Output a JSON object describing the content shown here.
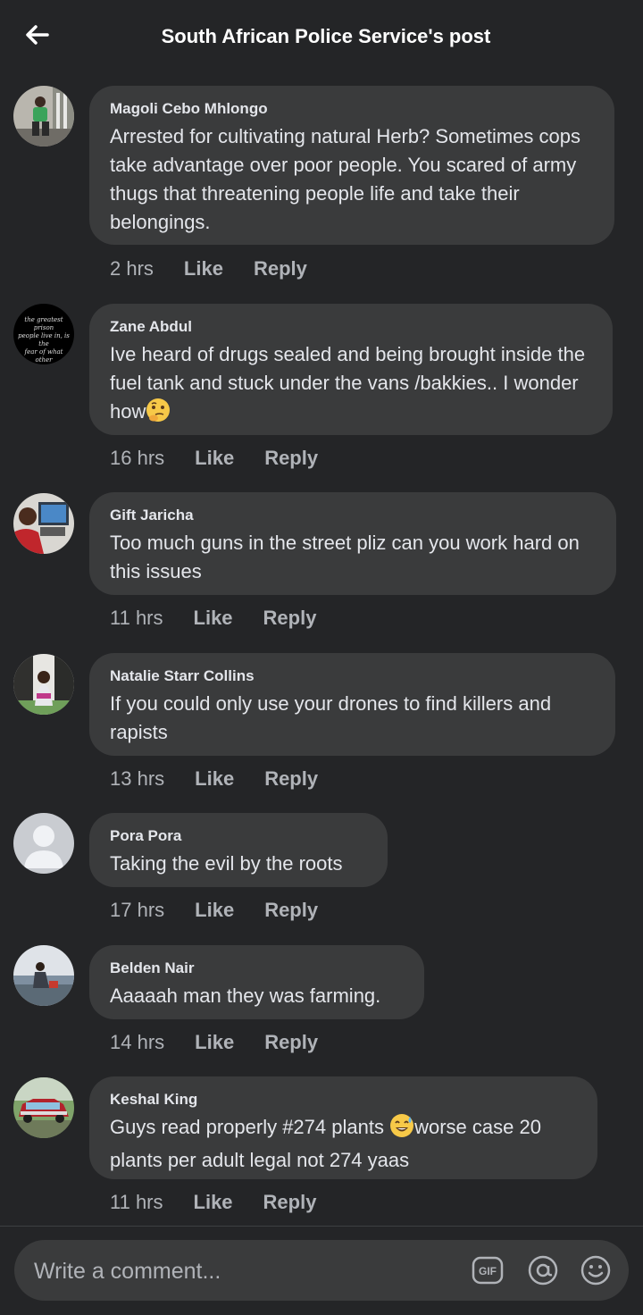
{
  "header": {
    "title": "South African Police Service's post",
    "back_icon": "arrow-left-icon"
  },
  "comments": [
    {
      "author": "Magoli Cebo Mhlongo",
      "text": "Arrested for cultivating natural Herb? Sometimes cops take advantage over poor people. You scared of army thugs that threatening people life and take their belongings.",
      "time": "2 hrs",
      "like": "Like",
      "reply": "Reply"
    },
    {
      "author": "Zane Abdul",
      "text": "Ive heard of drugs sealed and being brought inside the fuel tank and stuck under the vans /bakkies.. I wonder how",
      "emoji": "thinking-face-emoji",
      "time": "16 hrs",
      "like": "Like",
      "reply": "Reply",
      "avatar_text": "the greatest prison people live in, is the fear of what other people think."
    },
    {
      "author": "Gift Jaricha",
      "text": "Too much guns in the street pliz can you work hard on this issues",
      "time": "11 hrs",
      "like": "Like",
      "reply": "Reply"
    },
    {
      "author": "Natalie Starr Collins",
      "text": "If you could only use your drones to find killers and rapists",
      "time": "13 hrs",
      "like": "Like",
      "reply": "Reply"
    },
    {
      "author": "Pora Pora",
      "text": "Taking the evil by the roots",
      "time": "17 hrs",
      "like": "Like",
      "reply": "Reply"
    },
    {
      "author": "Belden Nair",
      "text": "Aaaaah man they was farming.",
      "time": "14 hrs",
      "like": "Like",
      "reply": "Reply"
    },
    {
      "author": "Keshal King",
      "text_before": "Guys read properly #274 plants ",
      "emoji": "grinning-sweat-emoji",
      "text_after": "worse case 20 plants per adult legal not 274 yaas",
      "time": "11 hrs",
      "like": "Like",
      "reply": "Reply"
    }
  ],
  "composer": {
    "placeholder": "Write a comment...",
    "icons": [
      "gif-icon",
      "mention-icon",
      "emoji-icon"
    ],
    "gif_label": "GIF"
  },
  "colors": {
    "background": "#242527",
    "bubble": "#3a3b3c",
    "text_primary": "#e4e6eb",
    "text_secondary": "#b0b3b8"
  }
}
